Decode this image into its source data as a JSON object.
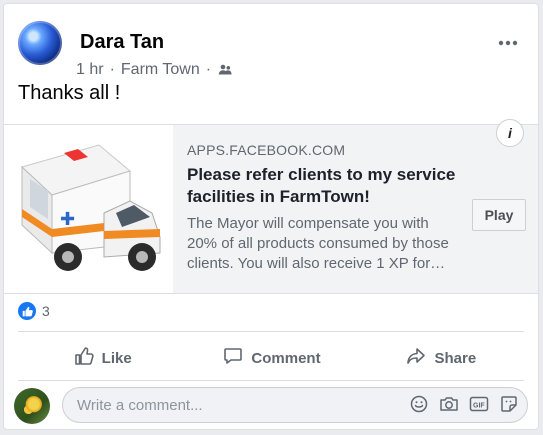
{
  "post": {
    "author": "Dara Tan",
    "time": "1 hr",
    "separator": "·",
    "group": "Farm Town",
    "text": "Thanks all !"
  },
  "link_preview": {
    "domain": "APPS.FACEBOOK.COM",
    "title": "Please refer clients to my service facilities in FarmTown!",
    "description": "The Mayor will compensate you with 20% of all products consumed by those clients. You will also receive 1 XP for…",
    "button_label": "Play",
    "info_label": "i"
  },
  "reactions": {
    "count": "3"
  },
  "actions": {
    "like": "Like",
    "comment": "Comment",
    "share": "Share"
  },
  "composer": {
    "placeholder": "Write a comment..."
  },
  "colors": {
    "brand": "#1877f2",
    "muted_text": "#606770",
    "link_bg": "#f2f3f5"
  },
  "icons": [
    "more-options-icon",
    "group-icon",
    "info-icon",
    "like-badge-icon",
    "like-icon",
    "comment-icon",
    "share-icon",
    "emoji-icon",
    "camera-icon",
    "gif-icon",
    "sticker-icon"
  ]
}
